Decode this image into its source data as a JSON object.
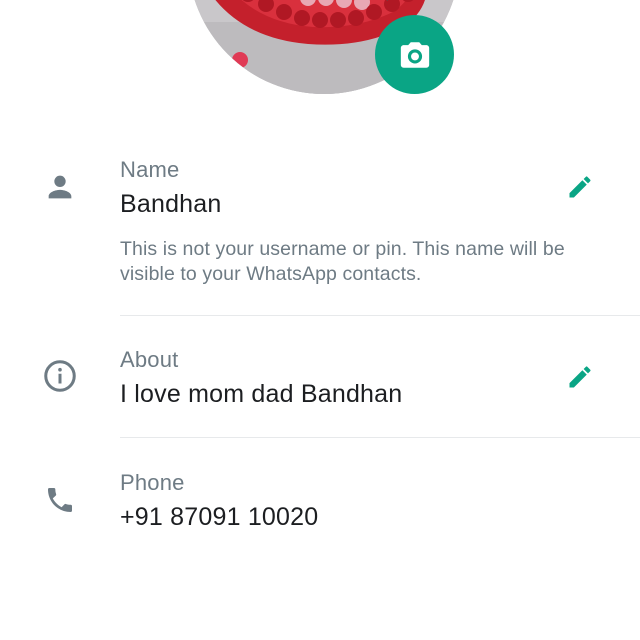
{
  "profile": {
    "photo_description_icon": "heart-shaped-photo",
    "camera_icon": "camera-icon"
  },
  "name": {
    "label": "Name",
    "value": "Bandhan",
    "help": "This is not your username or pin. This name will be visible to your WhatsApp contacts.",
    "icon": "person-icon",
    "edit_icon": "pencil-icon"
  },
  "about": {
    "label": "About",
    "value": "I love mom dad Bandhan",
    "icon": "info-icon",
    "edit_icon": "pencil-icon"
  },
  "phone": {
    "label": "Phone",
    "value": "+91 87091 10020",
    "icon": "phone-icon"
  },
  "colors": {
    "accent": "#0aa585",
    "icon_gray": "#6e7b84",
    "label_gray": "#6e7b84",
    "text": "#1c1e21",
    "divider": "#e7e9eb"
  }
}
